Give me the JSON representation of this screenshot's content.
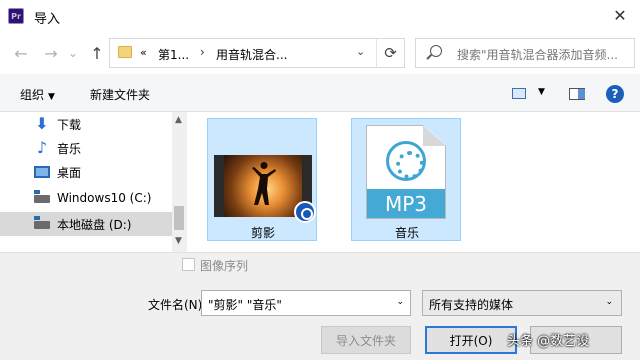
{
  "window": {
    "title": "导入",
    "app_icon_text": "Pr",
    "close_glyph": "✕"
  },
  "nav": {
    "back_glyph": "←",
    "forward_glyph": "→",
    "dropdown_glyph": "⌄",
    "up_glyph": "↑",
    "address": {
      "overflow": "«",
      "crumb_1": "第1...",
      "sep": "›",
      "crumb_2": "用音轨混合...",
      "dropdown_glyph": "⌄"
    },
    "refresh_glyph": "⟳",
    "search_placeholder": "搜索\"用音轨混合器添加音频..."
  },
  "toolbar": {
    "organize": "组织",
    "new_folder": "新建文件夹",
    "help": "?"
  },
  "sidebar": {
    "items": [
      {
        "label": "下载",
        "icon": "download-icon"
      },
      {
        "label": "音乐",
        "icon": "music-icon"
      },
      {
        "label": "桌面",
        "icon": "desktop-icon"
      },
      {
        "label": "Windows10 (C:)",
        "icon": "drive-icon"
      },
      {
        "label": "本地磁盘 (D:)",
        "icon": "drive-icon",
        "selected": true
      }
    ]
  },
  "files": [
    {
      "label": "剪影",
      "type": "video"
    },
    {
      "label": "音乐",
      "type": "mp3",
      "badge": "MP3"
    }
  ],
  "options": {
    "image_sequence": "图像序列"
  },
  "footer": {
    "filename_label": "文件名(N):",
    "filename_value": "\"剪影\" \"音乐\"",
    "filter_value": "所有支持的媒体",
    "import_folder_button": "导入文件夹",
    "open_button": "打开(O)"
  },
  "watermark": "头条 @数艺设",
  "colors": {
    "selection": "#cce8ff",
    "accent": "#2a79d6",
    "mp3": "#45a9d6"
  }
}
